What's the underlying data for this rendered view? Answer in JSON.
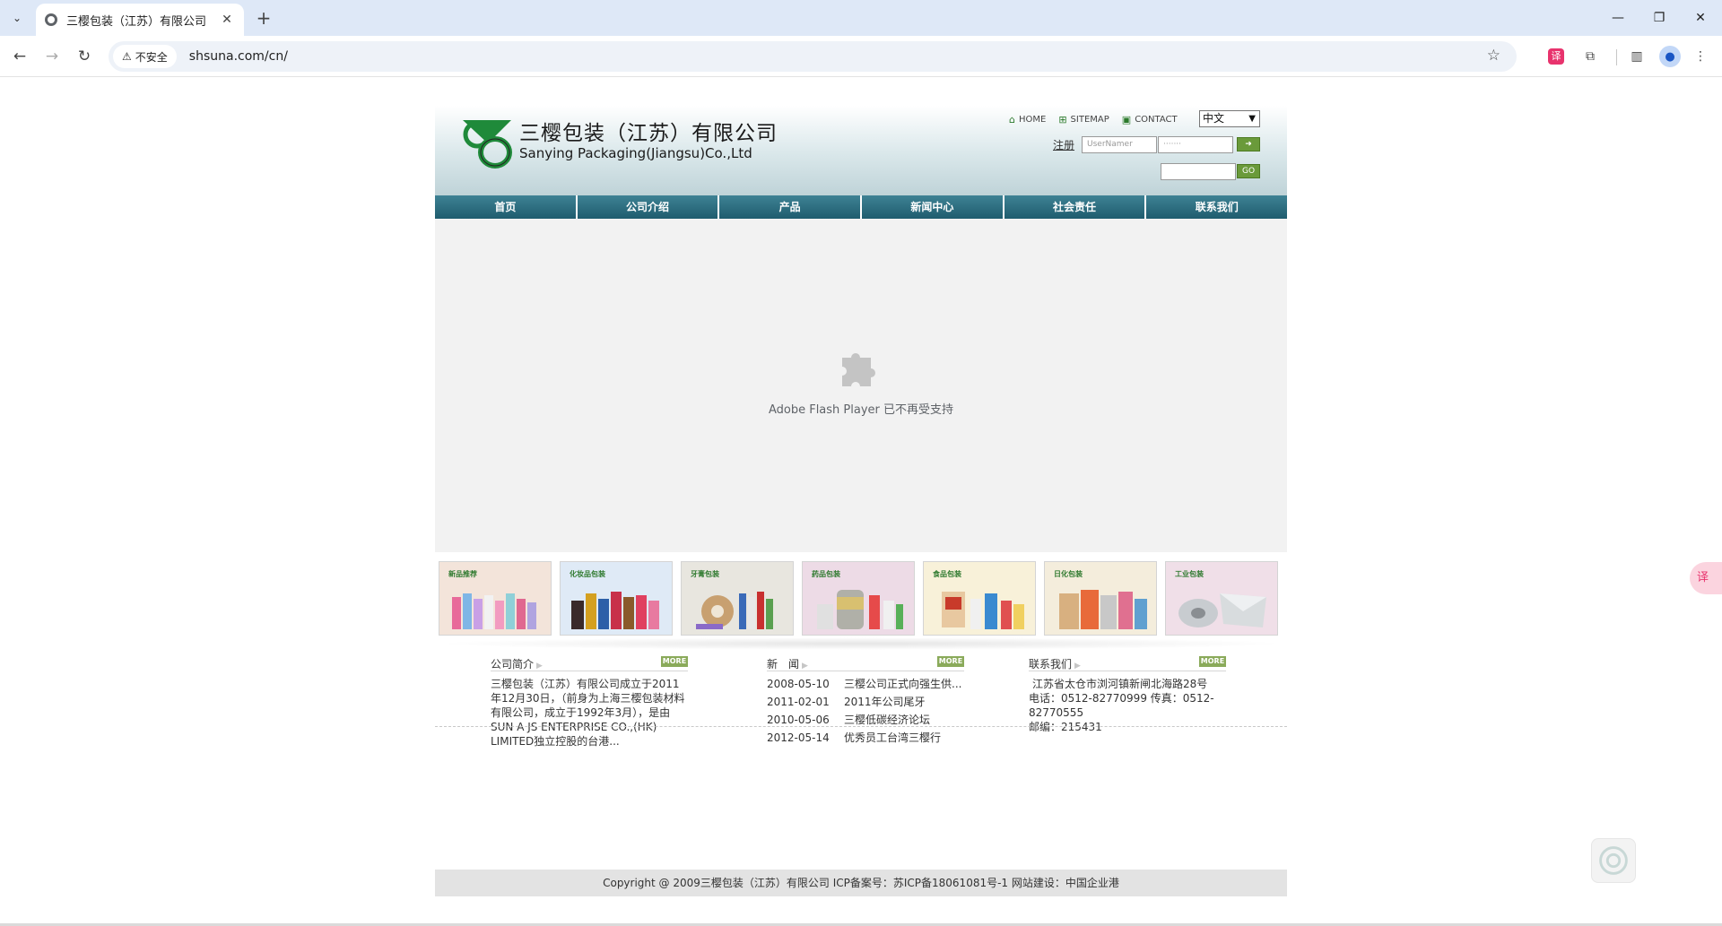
{
  "browser": {
    "tab_title": "三樱包装（江苏）有限公司",
    "security_label": "不安全",
    "url": "shsuna.com/cn/"
  },
  "header": {
    "company_cn": "三樱包装（江苏）有限公司",
    "company_en": "Sanying Packaging(Jiangsu)Co.,Ltd",
    "top_links": [
      "HOME",
      "SITEMAP",
      "CONTACT"
    ],
    "language": "中文",
    "register_label": "注册",
    "username_placeholder": "UserNamer",
    "password_placeholder": "·······",
    "search_go_label": "GO"
  },
  "nav": {
    "items": [
      "首页",
      "公司介绍",
      "产品",
      "新闻中心",
      "社会责任",
      "联系我们"
    ]
  },
  "flash": {
    "message": "Adobe Flash Player 已不再受支持"
  },
  "products": [
    {
      "label": "新品推荐",
      "bg": "#f3e4da"
    },
    {
      "label": "化妆品包装",
      "bg": "#dfeaf6"
    },
    {
      "label": "牙膏包装",
      "bg": "#e8e6df"
    },
    {
      "label": "药品包装",
      "bg": "#eddbe6"
    },
    {
      "label": "食品包装",
      "bg": "#f8f1d9"
    },
    {
      "label": "日化包装",
      "bg": "#f4eddc"
    },
    {
      "label": "工业包装",
      "bg": "#f0dfe8"
    }
  ],
  "about": {
    "heading": "公司简介",
    "more": "MORE",
    "text": "三樱包装（江苏）有限公司成立于2011年12月30日，（前身为上海三樱包装材料有限公司，成立于1992年3月），是由SUN A JS ENTERPRISE CO.,(HK) LIMITED独立控股的台港..."
  },
  "news": {
    "heading": "新　闻",
    "more": "MORE",
    "items": [
      {
        "date": "2008-05-10",
        "title": "三樱公司正式向强生供..."
      },
      {
        "date": "2011-02-01",
        "title": "2011年公司尾牙"
      },
      {
        "date": "2010-05-06",
        "title": "三樱低碳经济论坛"
      },
      {
        "date": "2012-05-14",
        "title": "优秀员工台湾三樱行"
      }
    ]
  },
  "contact": {
    "heading": "联系我们",
    "more": "MORE",
    "address": "江苏省太仓市浏河镇新闸北海路28号",
    "phone": "电话：0512-82770999 传真：0512-82770555",
    "postcode": "邮编：215431"
  },
  "footer": {
    "text": "Copyright @ 2009三樱包装（江苏）有限公司 ICP备案号：苏ICP备18061081号-1 网站建设：中国企业港"
  },
  "colors": {
    "nav_bg": "#1f5c6e",
    "accent_green": "#2f7a2f",
    "more_badge": "#8aaa5a"
  }
}
